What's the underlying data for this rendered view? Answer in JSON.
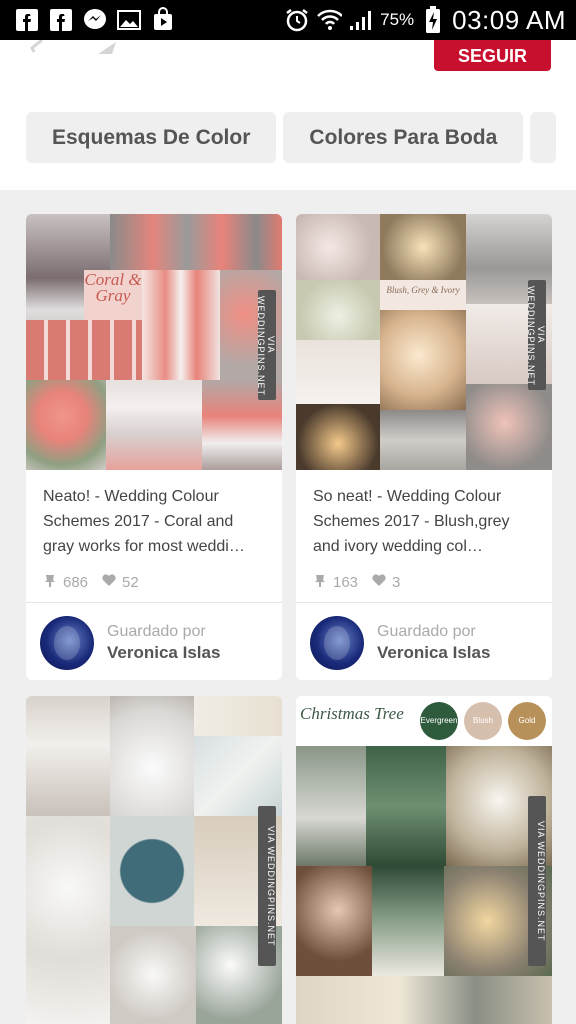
{
  "status_bar": {
    "battery": "75%",
    "time": "03:09 AM"
  },
  "header": {
    "follow_label": "SEGUIR"
  },
  "chips": [
    "Esquemas De Color",
    "Colores Para Boda"
  ],
  "pins": [
    {
      "description": "Neato! - Wedding Colour Schemes 2017 - Coral and gray works for most weddi…",
      "repins": "686",
      "likes": "52",
      "saved_by_label": "Guardado por",
      "saver": "Veronica Islas",
      "overlay_text": "Coral & Gray",
      "watermark": "VIA WEDDINGPINS.NET"
    },
    {
      "description": "So neat! - Wedding Colour Schemes 2017 - Blush,grey and ivory wedding col…",
      "repins": "163",
      "likes": "3",
      "saved_by_label": "Guardado por",
      "saver": "Veronica Islas",
      "overlay_text": "Blush, Grey & Ivory",
      "watermark": "VIA WEDDINGPINS.NET"
    },
    {
      "watermark": "VIA WEDDINGPINS.NET"
    },
    {
      "overlay_title": "Christmas Tree",
      "swatches": [
        "Evergreen",
        "Blush",
        "Gold"
      ],
      "watermark": "VIA WEDDINGPINS.NET"
    }
  ],
  "colors": {
    "accent": "#c8102e",
    "coral": "#e8837a",
    "gray": "#8a8a8a"
  }
}
